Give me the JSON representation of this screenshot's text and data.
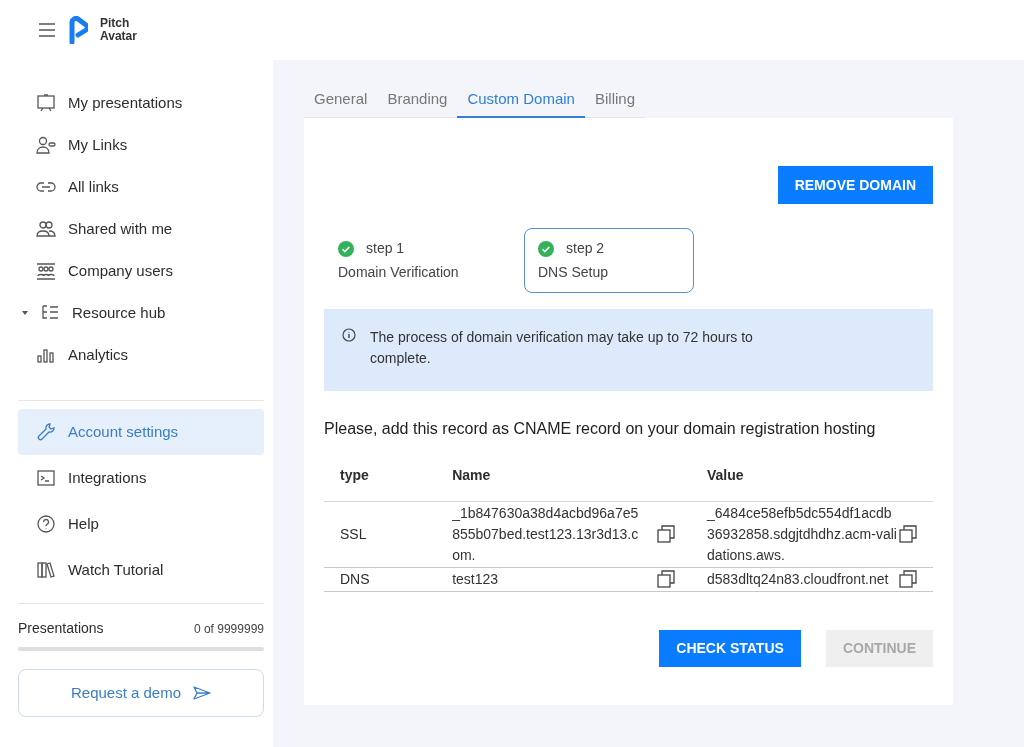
{
  "logo": {
    "line1": "Pitch",
    "line2": "Avatar"
  },
  "sidebar": {
    "items": [
      {
        "label": "My presentations",
        "selected": false,
        "kind": "link"
      },
      {
        "label": "My Links",
        "selected": false,
        "kind": "link"
      },
      {
        "label": "All links",
        "selected": false,
        "kind": "link"
      },
      {
        "label": "Shared with me",
        "selected": false,
        "kind": "link"
      },
      {
        "label": "Company users",
        "selected": false,
        "kind": "link"
      },
      {
        "label": "Resource hub",
        "selected": false,
        "kind": "group"
      },
      {
        "label": "Analytics",
        "selected": false,
        "kind": "link"
      }
    ],
    "bottom_items": [
      {
        "label": "Account settings",
        "selected": true
      },
      {
        "label": "Integrations",
        "selected": false
      },
      {
        "label": "Help",
        "selected": false
      },
      {
        "label": "Watch Tutorial",
        "selected": false
      }
    ],
    "usage": {
      "label": "Presentations",
      "count": "0 of 9999999",
      "level": 0
    },
    "demo_button": "Request a demo"
  },
  "tabs": [
    {
      "label": "General",
      "selected": false
    },
    {
      "label": "Branding",
      "selected": false
    },
    {
      "label": "Custom Domain",
      "selected": true
    },
    {
      "label": "Billing",
      "selected": false
    }
  ],
  "remove_button": "REMOVE DOMAIN",
  "steps": [
    {
      "label": "step 1",
      "title": "Domain Verification",
      "done": true,
      "selected": false
    },
    {
      "label": "step 2",
      "title": "DNS Setup",
      "done": true,
      "selected": true
    }
  ],
  "notice": "The process of domain verification may take up to 72 hours to complete.",
  "instruction": "Please, add this record as CNAME record on your domain registration hosting",
  "table": {
    "columns": [
      "type",
      "Name",
      "Value"
    ],
    "rows": [
      [
        "SSL",
        "_1b847630a38d4acbd96a7e5855b07bed.test123.13r3d13.com.",
        "_6484ce58efb5dc554df1acdb36932858.sdgjtdhdhz.acm-validations.aws."
      ],
      [
        "DNS",
        "test123",
        "d583dltq24n83.cloudfront.net"
      ]
    ]
  },
  "buttons": [
    {
      "label": "CHECK STATUS",
      "disabled": false
    },
    {
      "label": "CONTINUE",
      "disabled": true
    }
  ]
}
